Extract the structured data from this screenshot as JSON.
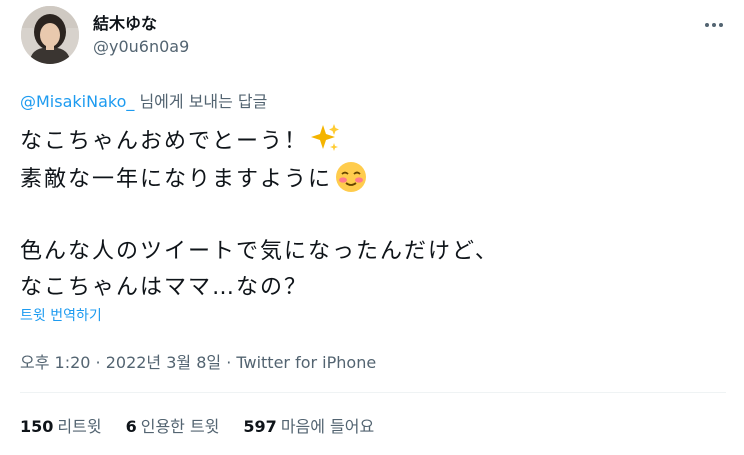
{
  "author": {
    "name": "結木ゆな",
    "handle": "@y0u6n0a9"
  },
  "reply": {
    "mention": "@MisakiNako_",
    "suffix": " 님에게 보내는 답글"
  },
  "tweet": {
    "line1": "なこちゃんおめでとーう！",
    "line2": "素敵な一年になりますように",
    "line3": "色んな人のツイートで気になったんだけど、",
    "line4": "なこちゃんはママ…なの？"
  },
  "translate_label": "트윗 번역하기",
  "meta": "오후 1:20 · 2022년 3월 8일 · Twitter for iPhone",
  "stats": {
    "retweets": "150",
    "retweets_label": "리트윗",
    "quotes": "6",
    "quotes_label": "인용한 트윗",
    "likes": "597",
    "likes_label": "마음에 들어요"
  },
  "icons": [
    "avatar",
    "more-icon",
    "sparkles-icon",
    "smiling-blush-icon"
  ],
  "colors": {
    "accent": "#1d9bf0",
    "secondary_text": "#536471",
    "divider": "#eff3f4"
  }
}
